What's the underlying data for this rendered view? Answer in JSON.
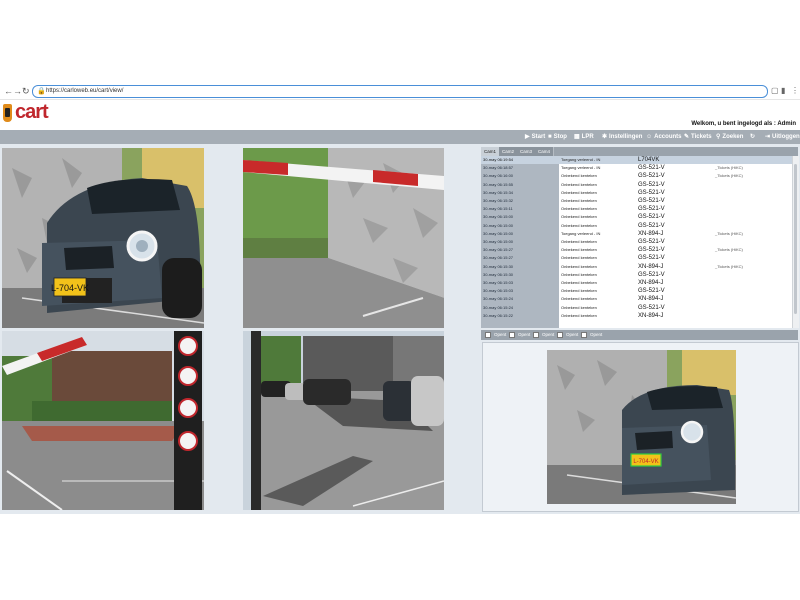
{
  "browser": {
    "back": "←",
    "forward": "→",
    "reload": "↻",
    "url": "https://carloweb.eu/cart/view/",
    "lock": "🔒",
    "ext1": "▢",
    "ext2": "▮",
    "menu": "⋮"
  },
  "header": {
    "logo": "cart",
    "welcome": "Welkom, u bent ingelogd als : Admin"
  },
  "toolbar": {
    "items": [
      {
        "label": "Start",
        "icon": "▶"
      },
      {
        "label": "Stop",
        "icon": "■"
      },
      {
        "label": "LPR",
        "icon": "▦"
      },
      {
        "label": "Instellingen",
        "icon": "✱"
      },
      {
        "label": "Accounts",
        "icon": "☺"
      },
      {
        "label": "Tickets",
        "icon": "✎"
      },
      {
        "label": "Zoeken",
        "icon": "⚲"
      },
      {
        "label": "",
        "icon": "↻"
      },
      {
        "label": "Uitloggen",
        "icon": "⇥"
      }
    ]
  },
  "tabs": [
    "Cam1",
    "Cam2",
    "Cam3",
    "Cam4"
  ],
  "log": [
    {
      "time": "30-may 06:19:54",
      "event": "Toegang verleend - IN",
      "plate": "L704VK",
      "extra": ""
    },
    {
      "time": "30-may 06:18:57",
      "event": "Toegang verleend - IN",
      "plate": "GS-521-V",
      "extra": "_Tickets (HiKC)"
    },
    {
      "time": "30-may 06:16:00",
      "event": "Onbekend kenteken",
      "plate": "GS-521-V",
      "extra": "_Tickets (HiKC)"
    },
    {
      "time": "30-may 06:15:55",
      "event": "Onbekend kenteken",
      "plate": "GS-521-V",
      "extra": ""
    },
    {
      "time": "30-may 06:15:34",
      "event": "Onbekend kenteken",
      "plate": "GS-521-V",
      "extra": ""
    },
    {
      "time": "30-may 06:15:32",
      "event": "Onbekend kenteken",
      "plate": "GS-521-V",
      "extra": ""
    },
    {
      "time": "30-may 06:15:11",
      "event": "Onbekend kenteken",
      "plate": "GS-521-V",
      "extra": ""
    },
    {
      "time": "30-may 06:15:00",
      "event": "Onbekend kenteken",
      "plate": "GS-521-V",
      "extra": ""
    },
    {
      "time": "30-may 06:15:00",
      "event": "Onbekend kenteken",
      "plate": "GS-521-V",
      "extra": ""
    },
    {
      "time": "30-may 06:15:00",
      "event": "Toegang verleend - IN",
      "plate": "XN-894-J",
      "extra": "_Tickets (HiKC)"
    },
    {
      "time": "30-may 06:15:00",
      "event": "Onbekend kenteken",
      "plate": "GS-521-V",
      "extra": ""
    },
    {
      "time": "30-may 06:15:27",
      "event": "Onbekend kenteken",
      "plate": "GS-521-V",
      "extra": "_Tickets (HiKC)"
    },
    {
      "time": "30-may 06:15:27",
      "event": "Onbekend kenteken",
      "plate": "GS-521-V",
      "extra": ""
    },
    {
      "time": "30-may 06:15:30",
      "event": "Onbekend kenteken",
      "plate": "XN-894-J",
      "extra": "_Tickets (HiKC)"
    },
    {
      "time": "30-may 06:15:30",
      "event": "Onbekend kenteken",
      "plate": "GS-521-V",
      "extra": ""
    },
    {
      "time": "30-may 06:15:03",
      "event": "Onbekend kenteken",
      "plate": "XN-894-J",
      "extra": ""
    },
    {
      "time": "30-may 06:15:03",
      "event": "Onbekend kenteken",
      "plate": "GS-521-V",
      "extra": ""
    },
    {
      "time": "30-may 06:15:24",
      "event": "Onbekend kenteken",
      "plate": "XN-894-J",
      "extra": ""
    },
    {
      "time": "30-may 06:15:24",
      "event": "Onbekend kenteken",
      "plate": "GS-521-V",
      "extra": ""
    },
    {
      "time": "30-may 06:15:22",
      "event": "Onbekend kenteken",
      "plate": "XN-894-J",
      "extra": ""
    }
  ],
  "options": [
    "Opent",
    "Opent",
    "Opent",
    "Opent",
    "Opent"
  ],
  "plates": {
    "cam1": "L-704-VK",
    "detail": "L-704-VK"
  }
}
